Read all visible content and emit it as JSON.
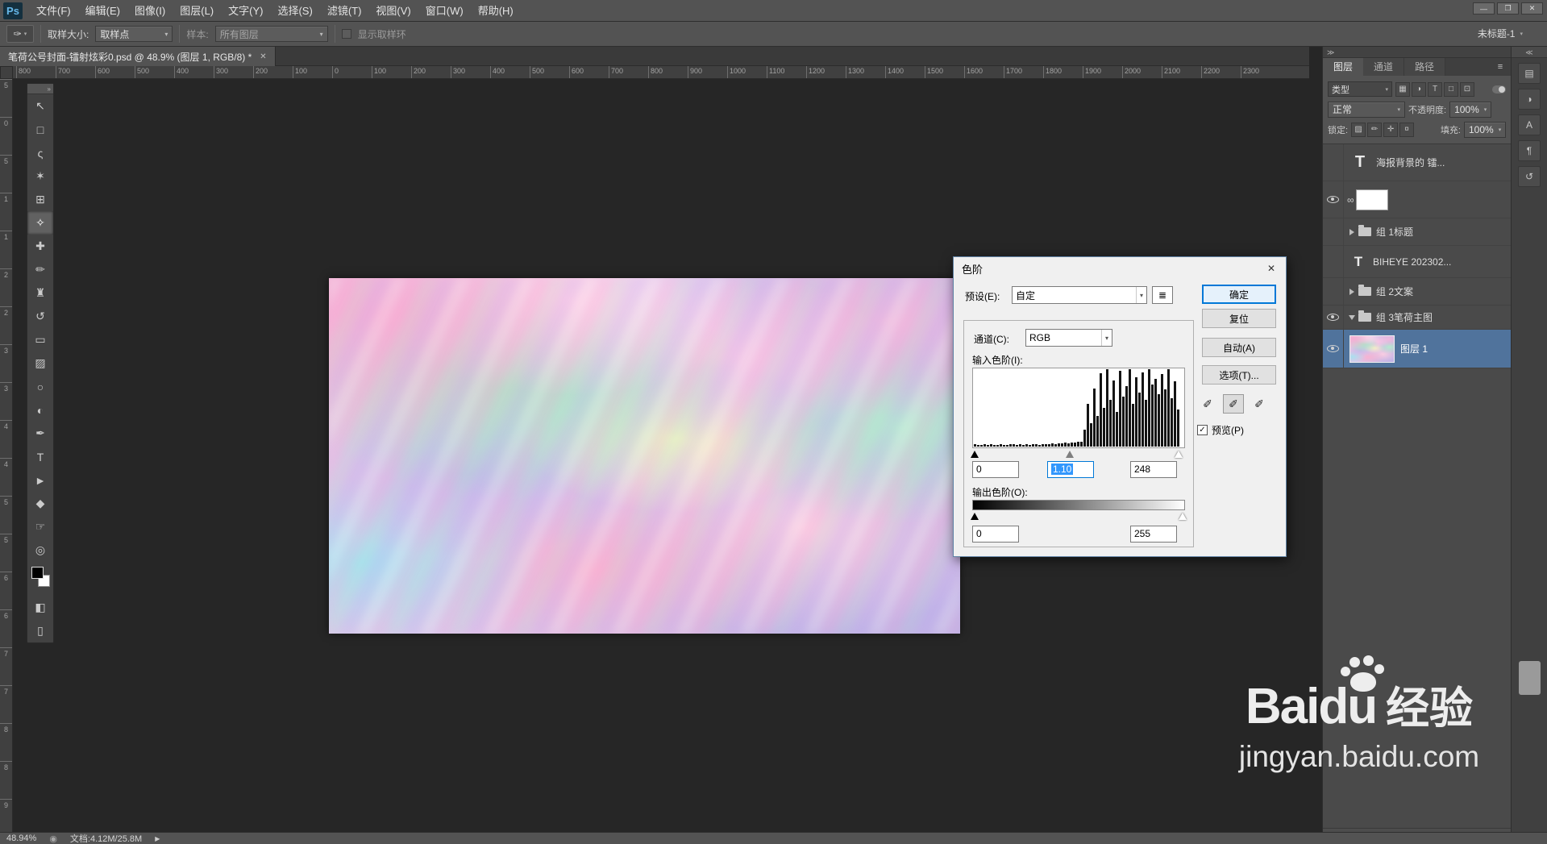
{
  "colors": {
    "chrome": "#535353",
    "pasteboard": "#262626",
    "dialog_bg": "#f0f0f0",
    "focus_blue": "#0078d7",
    "text_selection_blue": "#3297fd",
    "selected_layer_row": "#50739c"
  },
  "window": {
    "workspace": "未标题-1",
    "controls": {
      "minimize": "—",
      "restore": "❐",
      "close": "✕"
    }
  },
  "menu": {
    "logo": "Ps",
    "items": [
      "文件(F)",
      "编辑(E)",
      "图像(I)",
      "图层(L)",
      "文字(Y)",
      "选择(S)",
      "滤镜(T)",
      "视图(V)",
      "窗口(W)",
      "帮助(H)"
    ]
  },
  "options_bar": {
    "tool_glyph": "✑",
    "tool_chevron": "▾",
    "sample_size_label": "取样大小:",
    "sample_size_value": "取样点",
    "sample_label": "样本:",
    "sample_value": "所有图层",
    "show_ring_label": "显示取样环"
  },
  "document_tab": {
    "title": "笔荷公号封面-镭射炫彩0.psd @ 48.9% (图层 1, RGB/8) *",
    "close_glyph": "✕"
  },
  "rulers": {
    "horizontal": [
      "800",
      "700",
      "600",
      "500",
      "400",
      "300",
      "200",
      "100",
      "0",
      "100",
      "200",
      "300",
      "400",
      "500",
      "600",
      "700",
      "800",
      "900",
      "1000",
      "1100",
      "1200",
      "1300",
      "1400",
      "1500",
      "1600",
      "1700",
      "1800",
      "1900",
      "2000",
      "2100",
      "2200",
      "2300"
    ],
    "vertical": [
      "5",
      "0",
      "5",
      "1",
      "1",
      "2",
      "2",
      "3",
      "3",
      "4",
      "4",
      "5",
      "5",
      "6",
      "6",
      "7",
      "7",
      "8",
      "8",
      "9"
    ]
  },
  "toolbar": {
    "collapse_glyph": "»",
    "tools": [
      {
        "name": "move-tool",
        "glyph": "↖"
      },
      {
        "name": "marquee-tool",
        "glyph": "□"
      },
      {
        "name": "lasso-tool",
        "glyph": "ς"
      },
      {
        "name": "quick-selection-tool",
        "glyph": "✶"
      },
      {
        "name": "crop-tool",
        "glyph": "⊞"
      },
      {
        "name": "eyedropper-tool",
        "glyph": "✧",
        "active": true
      },
      {
        "name": "spot-healing-tool",
        "glyph": "✚"
      },
      {
        "name": "brush-tool",
        "glyph": "✏"
      },
      {
        "name": "clone-stamp-tool",
        "glyph": "♜"
      },
      {
        "name": "history-brush-tool",
        "glyph": "↺"
      },
      {
        "name": "eraser-tool",
        "glyph": "▭"
      },
      {
        "name": "gradient-tool",
        "glyph": "▨"
      },
      {
        "name": "blur-tool",
        "glyph": "○"
      },
      {
        "name": "dodge-tool",
        "glyph": "◐"
      },
      {
        "name": "pen-tool",
        "glyph": "✒"
      },
      {
        "name": "type-tool",
        "glyph": "T"
      },
      {
        "name": "path-selection-tool",
        "glyph": "►"
      },
      {
        "name": "shape-tool",
        "glyph": "◆"
      },
      {
        "name": "hand-tool",
        "glyph": "☞"
      },
      {
        "name": "zoom-tool",
        "glyph": "◎"
      }
    ],
    "foreground_color": "#000000",
    "background_color": "#ffffff",
    "bottom_tools": [
      {
        "name": "quick-mask-tool",
        "glyph": "◧"
      },
      {
        "name": "screen-mode-tool",
        "glyph": "▯"
      }
    ]
  },
  "levels_dialog": {
    "title": "色阶",
    "close_glyph": "✕",
    "preset_label": "预设(E):",
    "preset_value": "自定",
    "preset_menu_glyph": "≣",
    "channel_label": "通道(C):",
    "channel_value": "RGB",
    "input_label": "输入色阶(I):",
    "input_shadow": "0",
    "input_gamma": "1.10",
    "input_highlight": "248",
    "output_label": "输出色阶(O):",
    "output_shadow": "0",
    "output_highlight": "255",
    "ok_label": "确定",
    "reset_label": "复位",
    "auto_label": "自动(A)",
    "options_label": "选项(T)...",
    "preview_label": "预览(P)",
    "preview_checked": "✓",
    "dropper_glyph": "✐",
    "chevron": "▾",
    "slider_positions": {
      "input_black_pct": 1,
      "input_gamma_pct": 46,
      "input_white_pct": 97,
      "output_black_pct": 1,
      "output_white_pct": 99
    },
    "histogram": [
      3,
      2,
      2,
      3,
      2,
      3,
      2,
      2,
      3,
      2,
      2,
      3,
      3,
      2,
      3,
      2,
      3,
      2,
      3,
      3,
      2,
      3,
      3,
      3,
      4,
      3,
      4,
      4,
      5,
      4,
      5,
      5,
      6,
      6,
      22,
      55,
      30,
      75,
      40,
      95,
      50,
      100,
      60,
      85,
      45,
      98,
      65,
      78,
      100,
      55,
      90,
      70,
      96,
      60,
      100,
      80,
      88,
      68,
      94,
      74,
      100,
      62,
      84,
      48
    ]
  },
  "layers_panel": {
    "dock_collapse_glyph": "≫",
    "panel_menu_glyph": "≡",
    "tabs": [
      {
        "label": "图层",
        "active": true
      },
      {
        "label": "通道",
        "active": false
      },
      {
        "label": "路径",
        "active": false
      }
    ],
    "filter_label": "类型",
    "filter_icons": [
      {
        "name": "filter-pixel-icon",
        "glyph": "▦"
      },
      {
        "name": "filter-adjustment-icon",
        "glyph": "◑"
      },
      {
        "name": "filter-type-icon",
        "glyph": "T"
      },
      {
        "name": "filter-shape-icon",
        "glyph": "□"
      },
      {
        "name": "filter-smart-icon",
        "glyph": "⊡"
      }
    ],
    "blend_mode": "正常",
    "opacity_label": "不透明度:",
    "opacity_value": "100%",
    "lock_label": "锁定:",
    "lock_icons": [
      {
        "name": "lock-transparent-icon",
        "glyph": "▨"
      },
      {
        "name": "lock-pixels-icon",
        "glyph": "✏"
      },
      {
        "name": "lock-position-icon",
        "glyph": "✛"
      },
      {
        "name": "lock-all-icon",
        "glyph": "¤"
      }
    ],
    "fill_label": "填充:",
    "fill_value": "100%",
    "link_glyph": "∞",
    "layers": [
      {
        "name": "海报背景的 镭...",
        "kind": "text",
        "visible": false,
        "selected": false
      },
      {
        "name": "",
        "kind": "fill",
        "visible": true,
        "selected": false
      },
      {
        "name": "组 1标题",
        "kind": "group",
        "expanded": false,
        "visible": false,
        "selected": false
      },
      {
        "name": "BIHEYE 202302...",
        "kind": "text",
        "visible": false,
        "selected": false
      },
      {
        "name": "组 2文案",
        "kind": "group",
        "expanded": false,
        "visible": false,
        "selected": false
      },
      {
        "name": "组 3笔荷主图",
        "kind": "group",
        "expanded": true,
        "visible": true,
        "selected": false
      },
      {
        "name": "图层 1",
        "kind": "image",
        "visible": true,
        "selected": true
      }
    ],
    "footer_icons": [
      {
        "name": "link-layers-icon",
        "glyph": "∞"
      },
      {
        "name": "layer-effects-icon",
        "glyph": "fx"
      },
      {
        "name": "layer-mask-icon",
        "glyph": "◨"
      },
      {
        "name": "adjustment-layer-icon",
        "glyph": "◑"
      },
      {
        "name": "layer-group-icon",
        "glyph": "▣"
      },
      {
        "name": "new-layer-icon",
        "glyph": "⊞"
      },
      {
        "name": "delete-layer-icon",
        "glyph": "⌦"
      }
    ]
  },
  "right_strip": {
    "collapse_glyph": "≪",
    "icons": [
      {
        "name": "color-panel-icon",
        "glyph": "▤"
      },
      {
        "name": "adjustments-panel-icon",
        "glyph": "◑"
      },
      {
        "name": "character-panel-icon",
        "glyph": "A"
      },
      {
        "name": "paragraph-panel-icon",
        "glyph": "¶"
      },
      {
        "name": "history-panel-icon",
        "glyph": "↺"
      }
    ]
  },
  "status_bar": {
    "zoom": "48.94%",
    "status_icon_glyph": "◉",
    "doc_info": "文档:4.12M/25.8M",
    "menu_arrow": "▶"
  },
  "watermark": {
    "brand": "Baidu",
    "brand_cn": "经验",
    "url": "jingyan.baidu.com"
  }
}
